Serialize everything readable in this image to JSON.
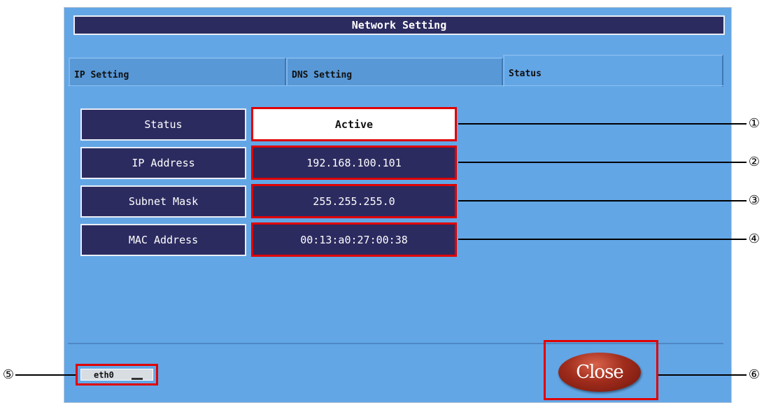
{
  "window": {
    "title": "Network Setting"
  },
  "tabs": [
    {
      "label": "IP Setting"
    },
    {
      "label": "DNS Setting"
    },
    {
      "label": "Status"
    }
  ],
  "status": {
    "rows": [
      {
        "label": "Status",
        "value": "Active"
      },
      {
        "label": "IP Address",
        "value": "192.168.100.101"
      },
      {
        "label": "Subnet Mask",
        "value": "255.255.255.0"
      },
      {
        "label": "MAC Address",
        "value": "00:13:a0:27:00:38"
      }
    ]
  },
  "interface_select": {
    "value": "eth0"
  },
  "close_button": {
    "label": "Close"
  },
  "callouts": [
    "①",
    "②",
    "③",
    "④",
    "⑤",
    "⑥"
  ],
  "colors": {
    "window_bg": "#63a6e6",
    "dark_box": "#2c2b60",
    "highlight": "#e00000"
  }
}
